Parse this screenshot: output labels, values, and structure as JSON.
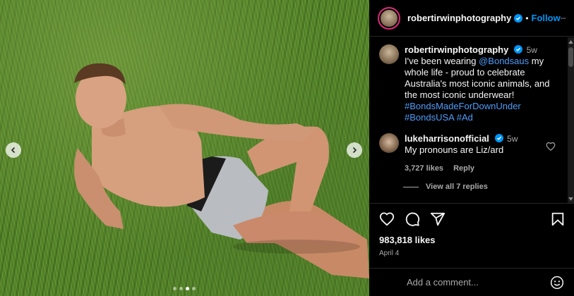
{
  "post": {
    "username": "robertirwinphotography",
    "follow_label": "Follow",
    "separator": "•",
    "caption": {
      "time": "5w",
      "prefix": "I've been wearing ",
      "mention": "@Bondsaus",
      "text": " my whole life - proud to celebrate Australia's most iconic animals, and the most iconic underwear!",
      "hashtags": "#BondsMadeForDownUnder #BondsUSA #Ad"
    },
    "comments": [
      {
        "username": "lukeharrisonofficial",
        "time": "5w",
        "text": "My pronouns are Liz/ard",
        "likes": "3,727 likes",
        "reply_label": "Reply",
        "view_replies": "View all 7 replies"
      }
    ],
    "likes": "983,818 likes",
    "date": "April 4"
  },
  "add_comment": {
    "placeholder": "Add a comment..."
  },
  "icons": {
    "prev": "chevron-left-icon",
    "next": "chevron-right-icon",
    "more": "more-horizontal-icon",
    "verified": "verified-badge-icon",
    "like": "heart-icon",
    "comment": "comment-icon",
    "share": "send-icon",
    "save": "bookmark-icon",
    "emoji": "smiley-icon"
  },
  "colors": {
    "accent": "#0095f6",
    "background": "#000000",
    "muted": "#a8a8a8"
  },
  "carousel": {
    "slides": 4,
    "active_index": 2
  }
}
